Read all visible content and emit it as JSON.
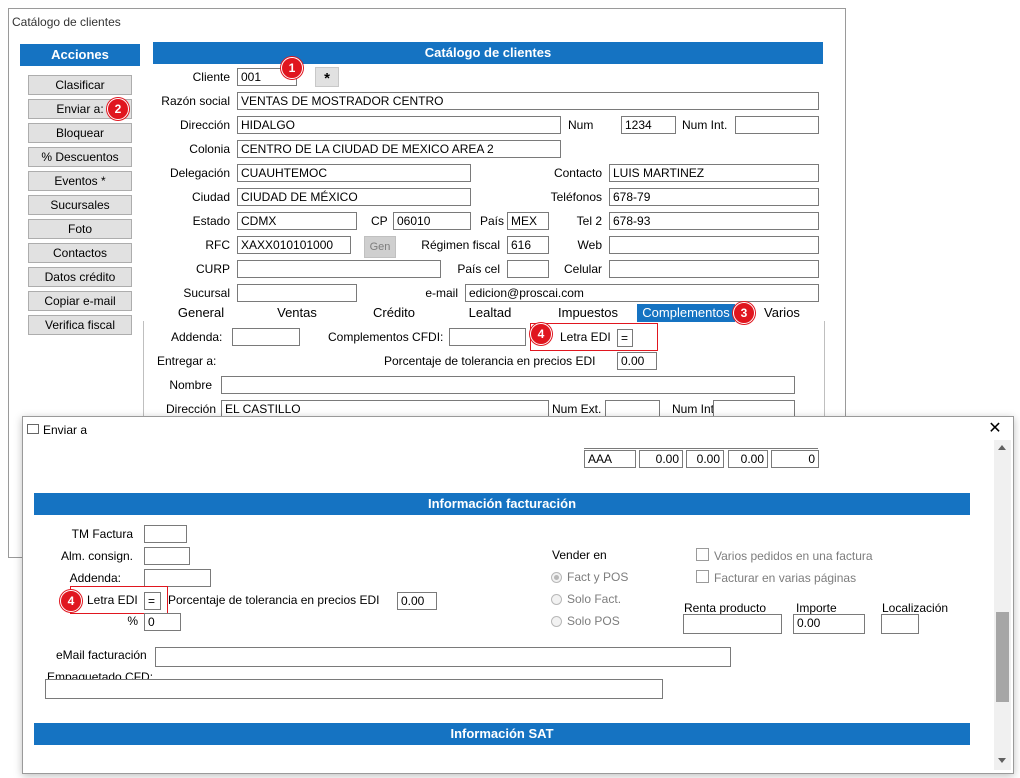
{
  "back_window": {
    "title": "Catálogo de clientes",
    "actions_header": "Acciones",
    "actions": [
      "Clasificar",
      "Enviar a:",
      "Bloquear",
      "% Descuentos",
      "Eventos *",
      "Sucursales",
      "Foto",
      "Contactos",
      "Datos crédito",
      "Copiar e-mail",
      "Verifica fiscal"
    ],
    "form_header": "Catálogo de clientes",
    "labels": {
      "cliente": "Cliente",
      "razon": "Razón social",
      "direccion": "Dirección",
      "num": "Num",
      "numint": "Num Int.",
      "colonia": "Colonia",
      "delegacion": "Delegación",
      "contacto": "Contacto",
      "ciudad": "Ciudad",
      "telefonos": "Teléfonos",
      "estado": "Estado",
      "cp": "CP",
      "pais": "País",
      "tel2": "Tel 2",
      "rfc": "RFC",
      "regimen": "Régimen fiscal",
      "web": "Web",
      "curp": "CURP",
      "paiscel": "País cel",
      "celular": "Celular",
      "sucursal": "Sucursal",
      "email": "e-mail"
    },
    "values": {
      "cliente": "001",
      "star_button": "*",
      "razon": "VENTAS DE MOSTRADOR CENTRO",
      "direccion": "HIDALGO",
      "num": "1234",
      "numint": "",
      "colonia": "CENTRO DE LA CIUDAD DE MEXICO AREA 2",
      "delegacion": "CUAUHTEMOC",
      "contacto": "LUIS MARTINEZ",
      "ciudad": "CIUDAD DE MÉXICO",
      "telefonos": "678-79",
      "estado": "CDMX",
      "cp": "06010",
      "pais": "MEX",
      "tel2": "678-93",
      "rfc": "XAXX010101000",
      "gen_button": "Gen",
      "regimen": "616",
      "web": "",
      "curp": "",
      "paiscel": "",
      "celular": "",
      "sucursal": "",
      "email": "edicion@proscai.com"
    },
    "tabs": [
      "General",
      "Ventas",
      "Crédito",
      "Lealtad",
      "Impuestos",
      "Complementos",
      "Varios"
    ],
    "comp": {
      "addenda_label": "Addenda:",
      "addenda": "",
      "cfdi_label": "Complementos CFDI:",
      "cfdi": "",
      "letra_label": "Letra EDI",
      "letra": "=",
      "entregar_label": "Entregar a:",
      "tol_label": "Porcentaje de tolerancia en precios EDI",
      "tol": "0.00",
      "nombre_label": "Nombre",
      "nombre": "",
      "dir_label": "Dirección",
      "dir": "EL CASTILLO",
      "numext_label": "Num Ext.",
      "numext": "",
      "numint_label": "Num Int",
      "numint": ""
    }
  },
  "front_window": {
    "title": "Enviar a",
    "close_icon": "close-icon",
    "grid_row": [
      "AAA",
      "0.00",
      "0.00",
      "0.00",
      "0"
    ],
    "factura_header": "Información facturación",
    "tm_label": "TM Factura",
    "tm": "",
    "alm_label": "Alm. consign.",
    "alm": "",
    "addenda_label": "Addenda:",
    "addenda": "",
    "letra_label": "Letra EDI",
    "letra": "=",
    "tol_label": "Porcentaje de tolerancia en precios EDI",
    "tol": "0.00",
    "pct_label": "%",
    "pct": "0",
    "vender_label": "Vender en",
    "vender_options": [
      "Fact y POS",
      "Solo Fact.",
      "Solo POS"
    ],
    "checks": [
      "Varios pedidos en una factura",
      "Facturar en varias páginas"
    ],
    "renta_label": "Renta producto",
    "renta": "",
    "importe_label": "Importe",
    "importe": "0.00",
    "local_label": "Localización",
    "local": "",
    "email_label": "eMail facturación",
    "email": "",
    "emp_label": "Empaquetado CFD:",
    "emp": "",
    "sat_header": "Información SAT"
  },
  "badges": [
    "1",
    "2",
    "3",
    "4",
    "4"
  ],
  "colors": {
    "accent": "#1573c2",
    "badge": "#e0161f"
  }
}
